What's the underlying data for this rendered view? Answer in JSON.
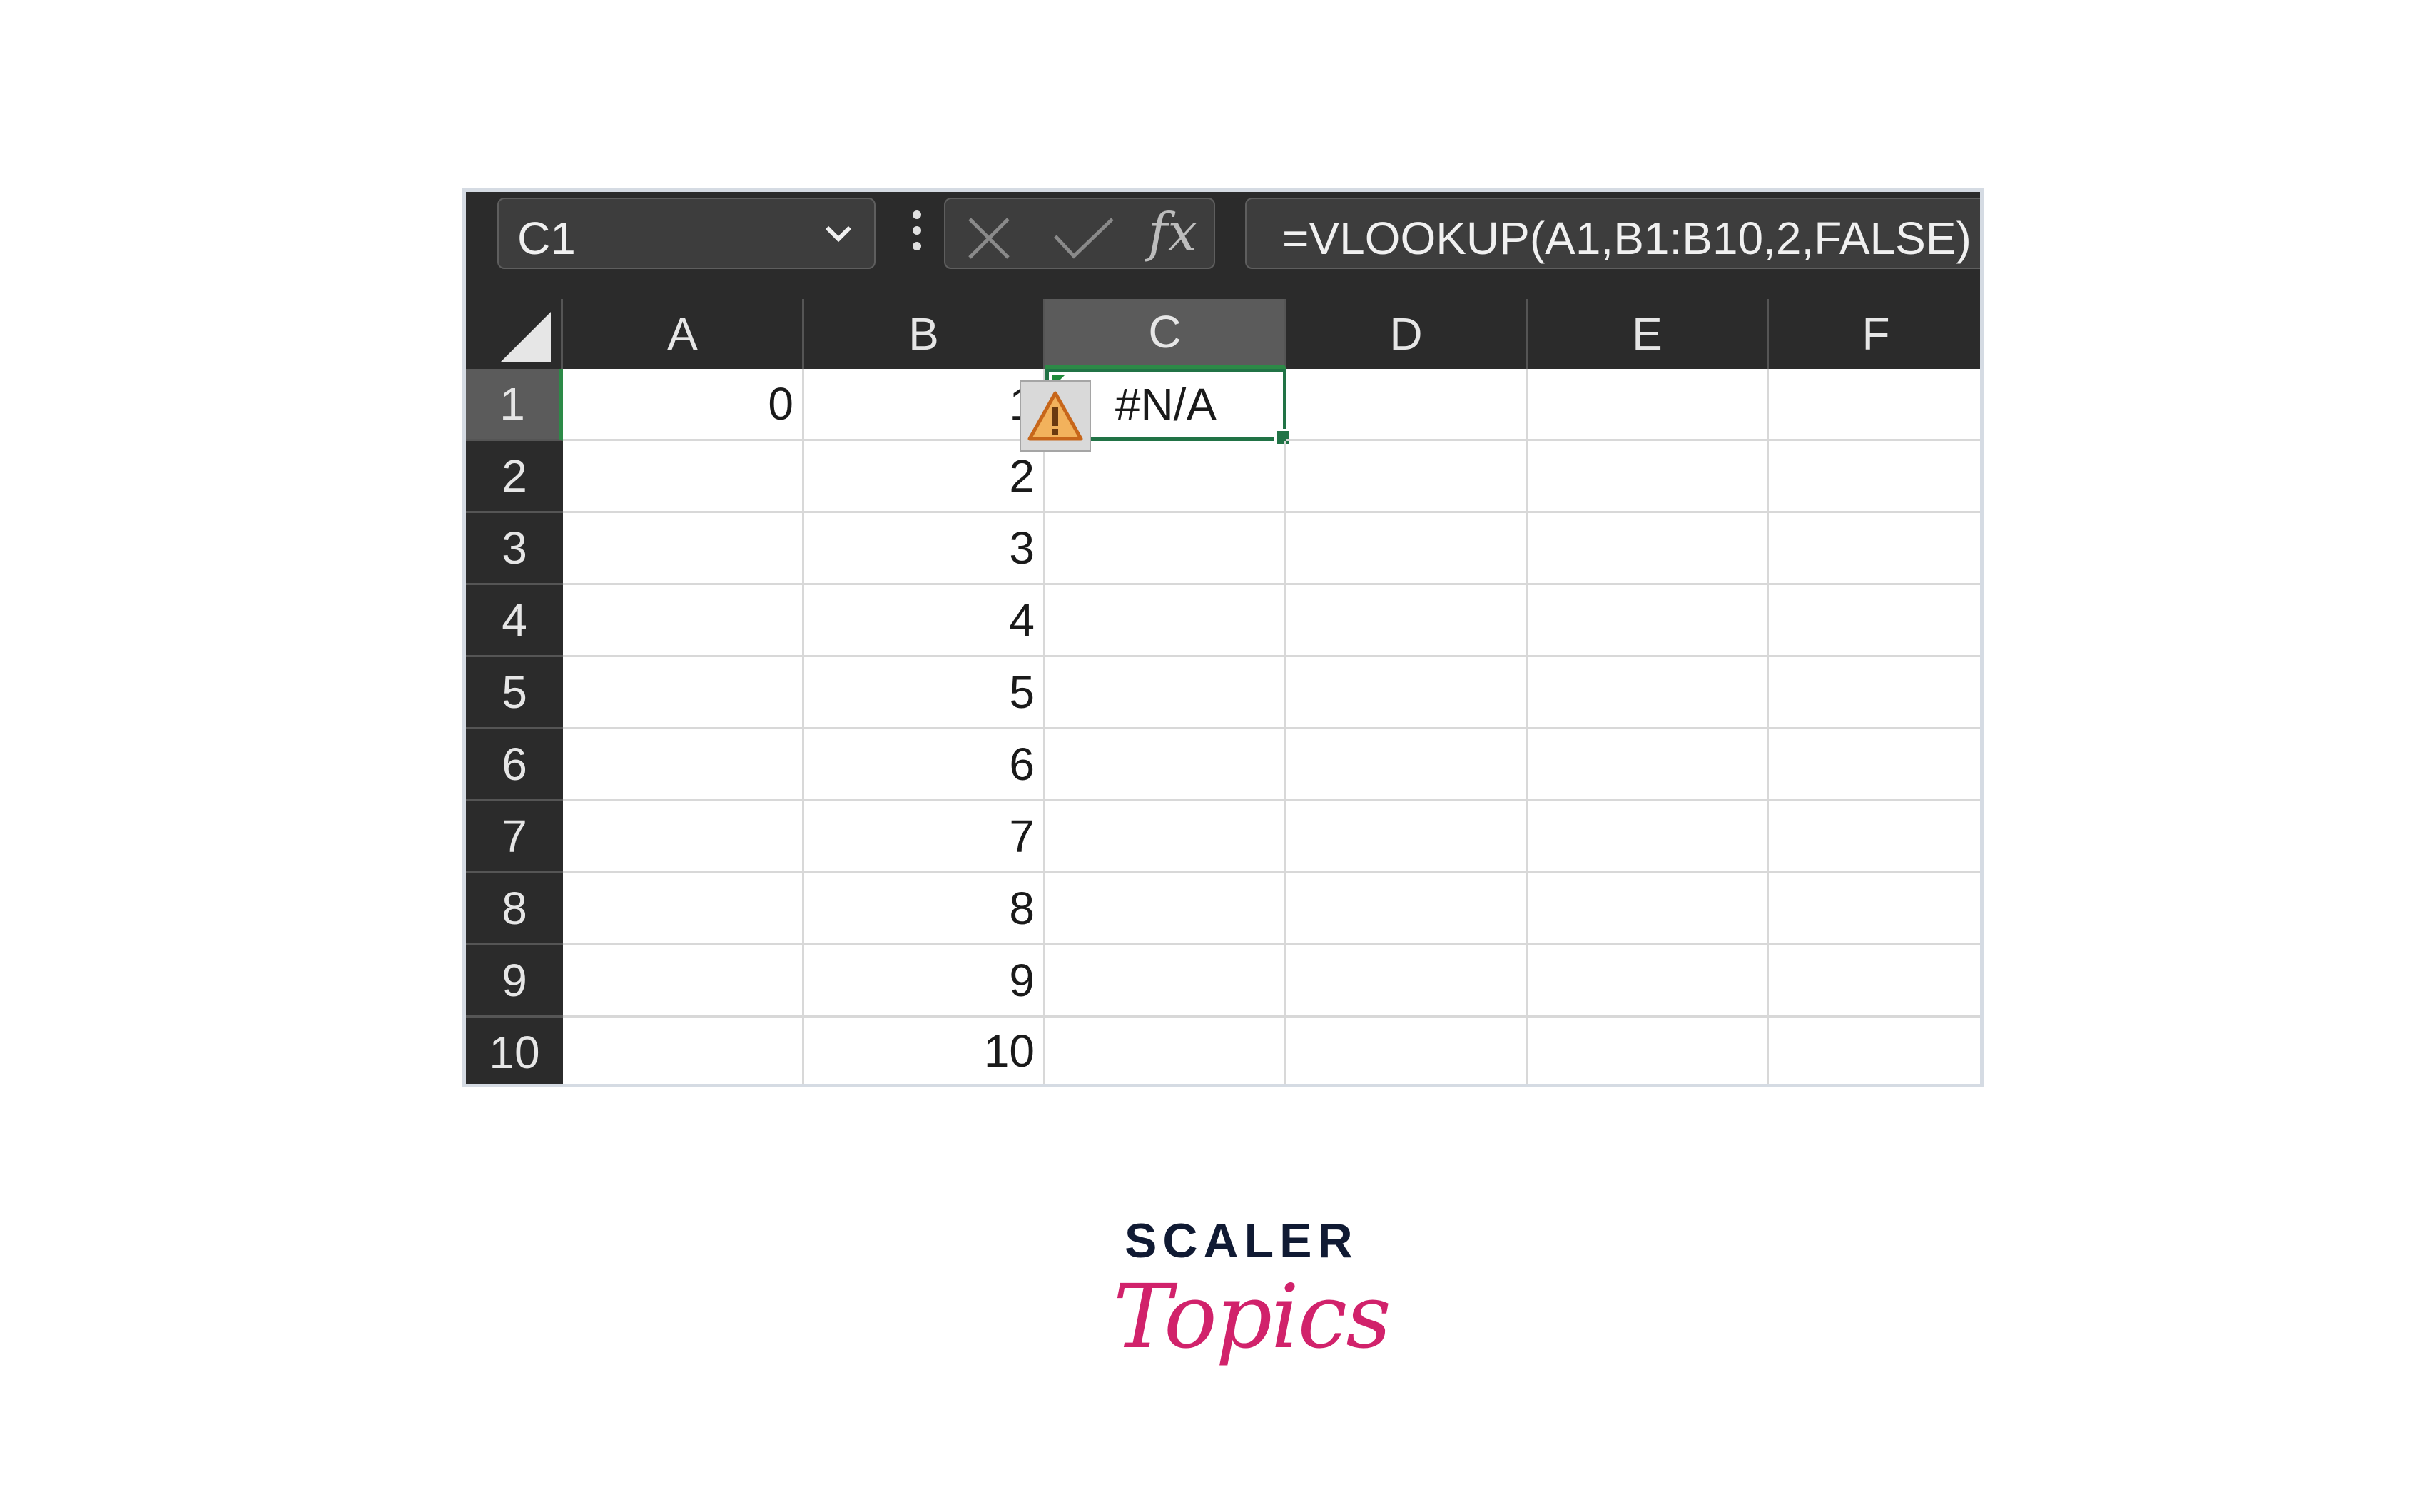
{
  "formula_bar": {
    "name_box": "C1",
    "formula": "=VLOOKUP(A1,B1:B10,2,FALSE)",
    "fx_label": "fx",
    "icons": [
      "chevron-down-icon",
      "more-vert-icon",
      "cancel-icon",
      "enter-icon",
      "function-icon"
    ]
  },
  "columns": [
    "A",
    "B",
    "C",
    "D",
    "E",
    "F"
  ],
  "rows": [
    "1",
    "2",
    "3",
    "4",
    "5",
    "6",
    "7",
    "8",
    "9",
    "10"
  ],
  "cells": {
    "A1": "0",
    "B1": "1",
    "B2": "2",
    "B3": "3",
    "B4": "4",
    "B5": "5",
    "B6": "6",
    "B7": "7",
    "B8": "8",
    "B9": "9",
    "B10": "10",
    "C1": "#N/A"
  },
  "selection": {
    "cell": "C1",
    "column": "C",
    "row": "1"
  },
  "logo": {
    "line1": "SCALER",
    "line2": "Topics"
  },
  "colors": {
    "accent_green": "#217346",
    "header_dark": "#2b2b2b",
    "brand_pink": "#d1226b",
    "warning_orange": "#e08a2c"
  }
}
